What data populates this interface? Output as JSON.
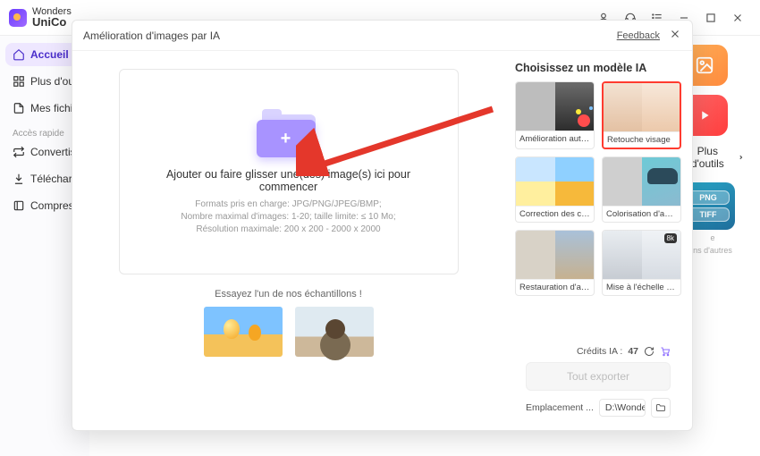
{
  "brand": {
    "line1": "Wonders",
    "line2": "UniCo"
  },
  "topbar_icons": [
    "user-icon",
    "headset-icon",
    "menu-icon",
    "minimize-icon",
    "maximize-icon",
    "close-icon"
  ],
  "sidebar": {
    "items": [
      {
        "label": "Accueil",
        "icon": "home-icon",
        "active": true
      },
      {
        "label": "Plus d'ou",
        "icon": "grid-icon"
      },
      {
        "label": "Mes fichi",
        "icon": "file-icon"
      }
    ],
    "section_label": "Accès rapide",
    "quick": [
      {
        "label": "Convertis",
        "icon": "convert-icon"
      },
      {
        "label": "Téléchar",
        "icon": "download-icon"
      },
      {
        "label": "Compres",
        "icon": "compress-icon"
      }
    ]
  },
  "main_right": {
    "more_tools": "Plus d'outils",
    "formats": [
      "PNG",
      "TIFF"
    ],
    "subtext1": "e",
    "subtext2": "ns d'autres"
  },
  "modal": {
    "title": "Amélioration d'images par IA",
    "feedback": "Feedback",
    "dropzone": {
      "title": "Ajouter ou faire glisser une(des) image(s) ici pour commencer",
      "line1": "Formats pris en charge: JPG/PNG/JPEG/BMP;",
      "line2": "Nombre maximal d'images: 1-20; taille limite: ≤ 10 Mo;",
      "line3": "Résolution maximale: 200 x 200 - 2000 x 2000"
    },
    "samples_label": "Essayez l'un de nos échantillons !",
    "models_title": "Choisissez un modèle IA",
    "models": [
      {
        "label": "Amélioration automat...",
        "cls": "m-auto",
        "selected": false
      },
      {
        "label": "Retouche visage",
        "cls": "m-face",
        "selected": true
      },
      {
        "label": "Correction des couleurs",
        "cls": "m-color",
        "selected": false
      },
      {
        "label": "Colorisation d'ancienn...",
        "cls": "m-old",
        "selected": false
      },
      {
        "label": "Restauration d'ancien...",
        "cls": "m-rest",
        "selected": false
      },
      {
        "label": "Mise à l'échelle des i...",
        "cls": "m-scale",
        "selected": false
      }
    ],
    "credits_label": "Crédits IA :",
    "credits_value": "47",
    "export_label": "Tout exporter",
    "location_label": "Emplacement ...",
    "location_value": "D:\\Wondershare UniConver"
  },
  "colors": {
    "accent": "#8c6cff",
    "highlight": "#ff3b2f"
  }
}
